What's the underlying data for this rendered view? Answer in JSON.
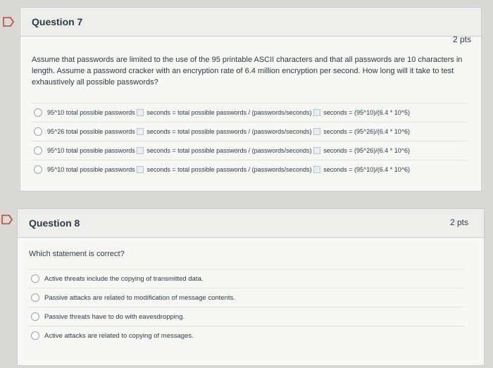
{
  "q7": {
    "title": "Question 7",
    "points": "2 pts",
    "text": "Assume that passwords are limited to the use of the 95 printable ASCII characters and that all passwords are 10 characters in length. Assume a password cracker with an encryption rate of 6.4 million encryption per second. How long will it take to test exhaustively all possible passwords?",
    "answers": [
      {
        "part1": "95^10 total possible passwords",
        "part2": "seconds = total possible passwords / (passwords/seconds)",
        "part3": "seconds = (95^10)/(6.4 * 10^5)"
      },
      {
        "part1": "95^26 total possible passwords",
        "part2": "seconds = total possible passwords / (passwords/seconds)",
        "part3": "seconds = (95^26)/(6.4 * 10^6)"
      },
      {
        "part1": "95^10 total possible passwords",
        "part2": "seconds = total possible passwords / (passwords/seconds)",
        "part3": "seconds = (95^26)/(6.4 * 10^6)"
      },
      {
        "part1": "95^10 total possible passwords",
        "part2": "seconds = total possible passwords / (passwords/seconds)",
        "part3": "seconds = (95^10)/(6.4 * 10^6)"
      }
    ]
  },
  "q8": {
    "title": "Question 8",
    "points": "2 pts",
    "text": "Which statement is correct?",
    "answers": [
      "Active threats include the copying of transmitted data.",
      "Passive attacks are related to modification of message contents.",
      "Passive threats have to do with eavesdropping.",
      "Active attacks are related to copying of messages."
    ]
  },
  "icons": {
    "flag": "flag-icon",
    "separator": "separator-icon"
  },
  "colors": {
    "flag": "#c0392b",
    "panel": "#f7f7f5",
    "header": "#eeeeec"
  }
}
